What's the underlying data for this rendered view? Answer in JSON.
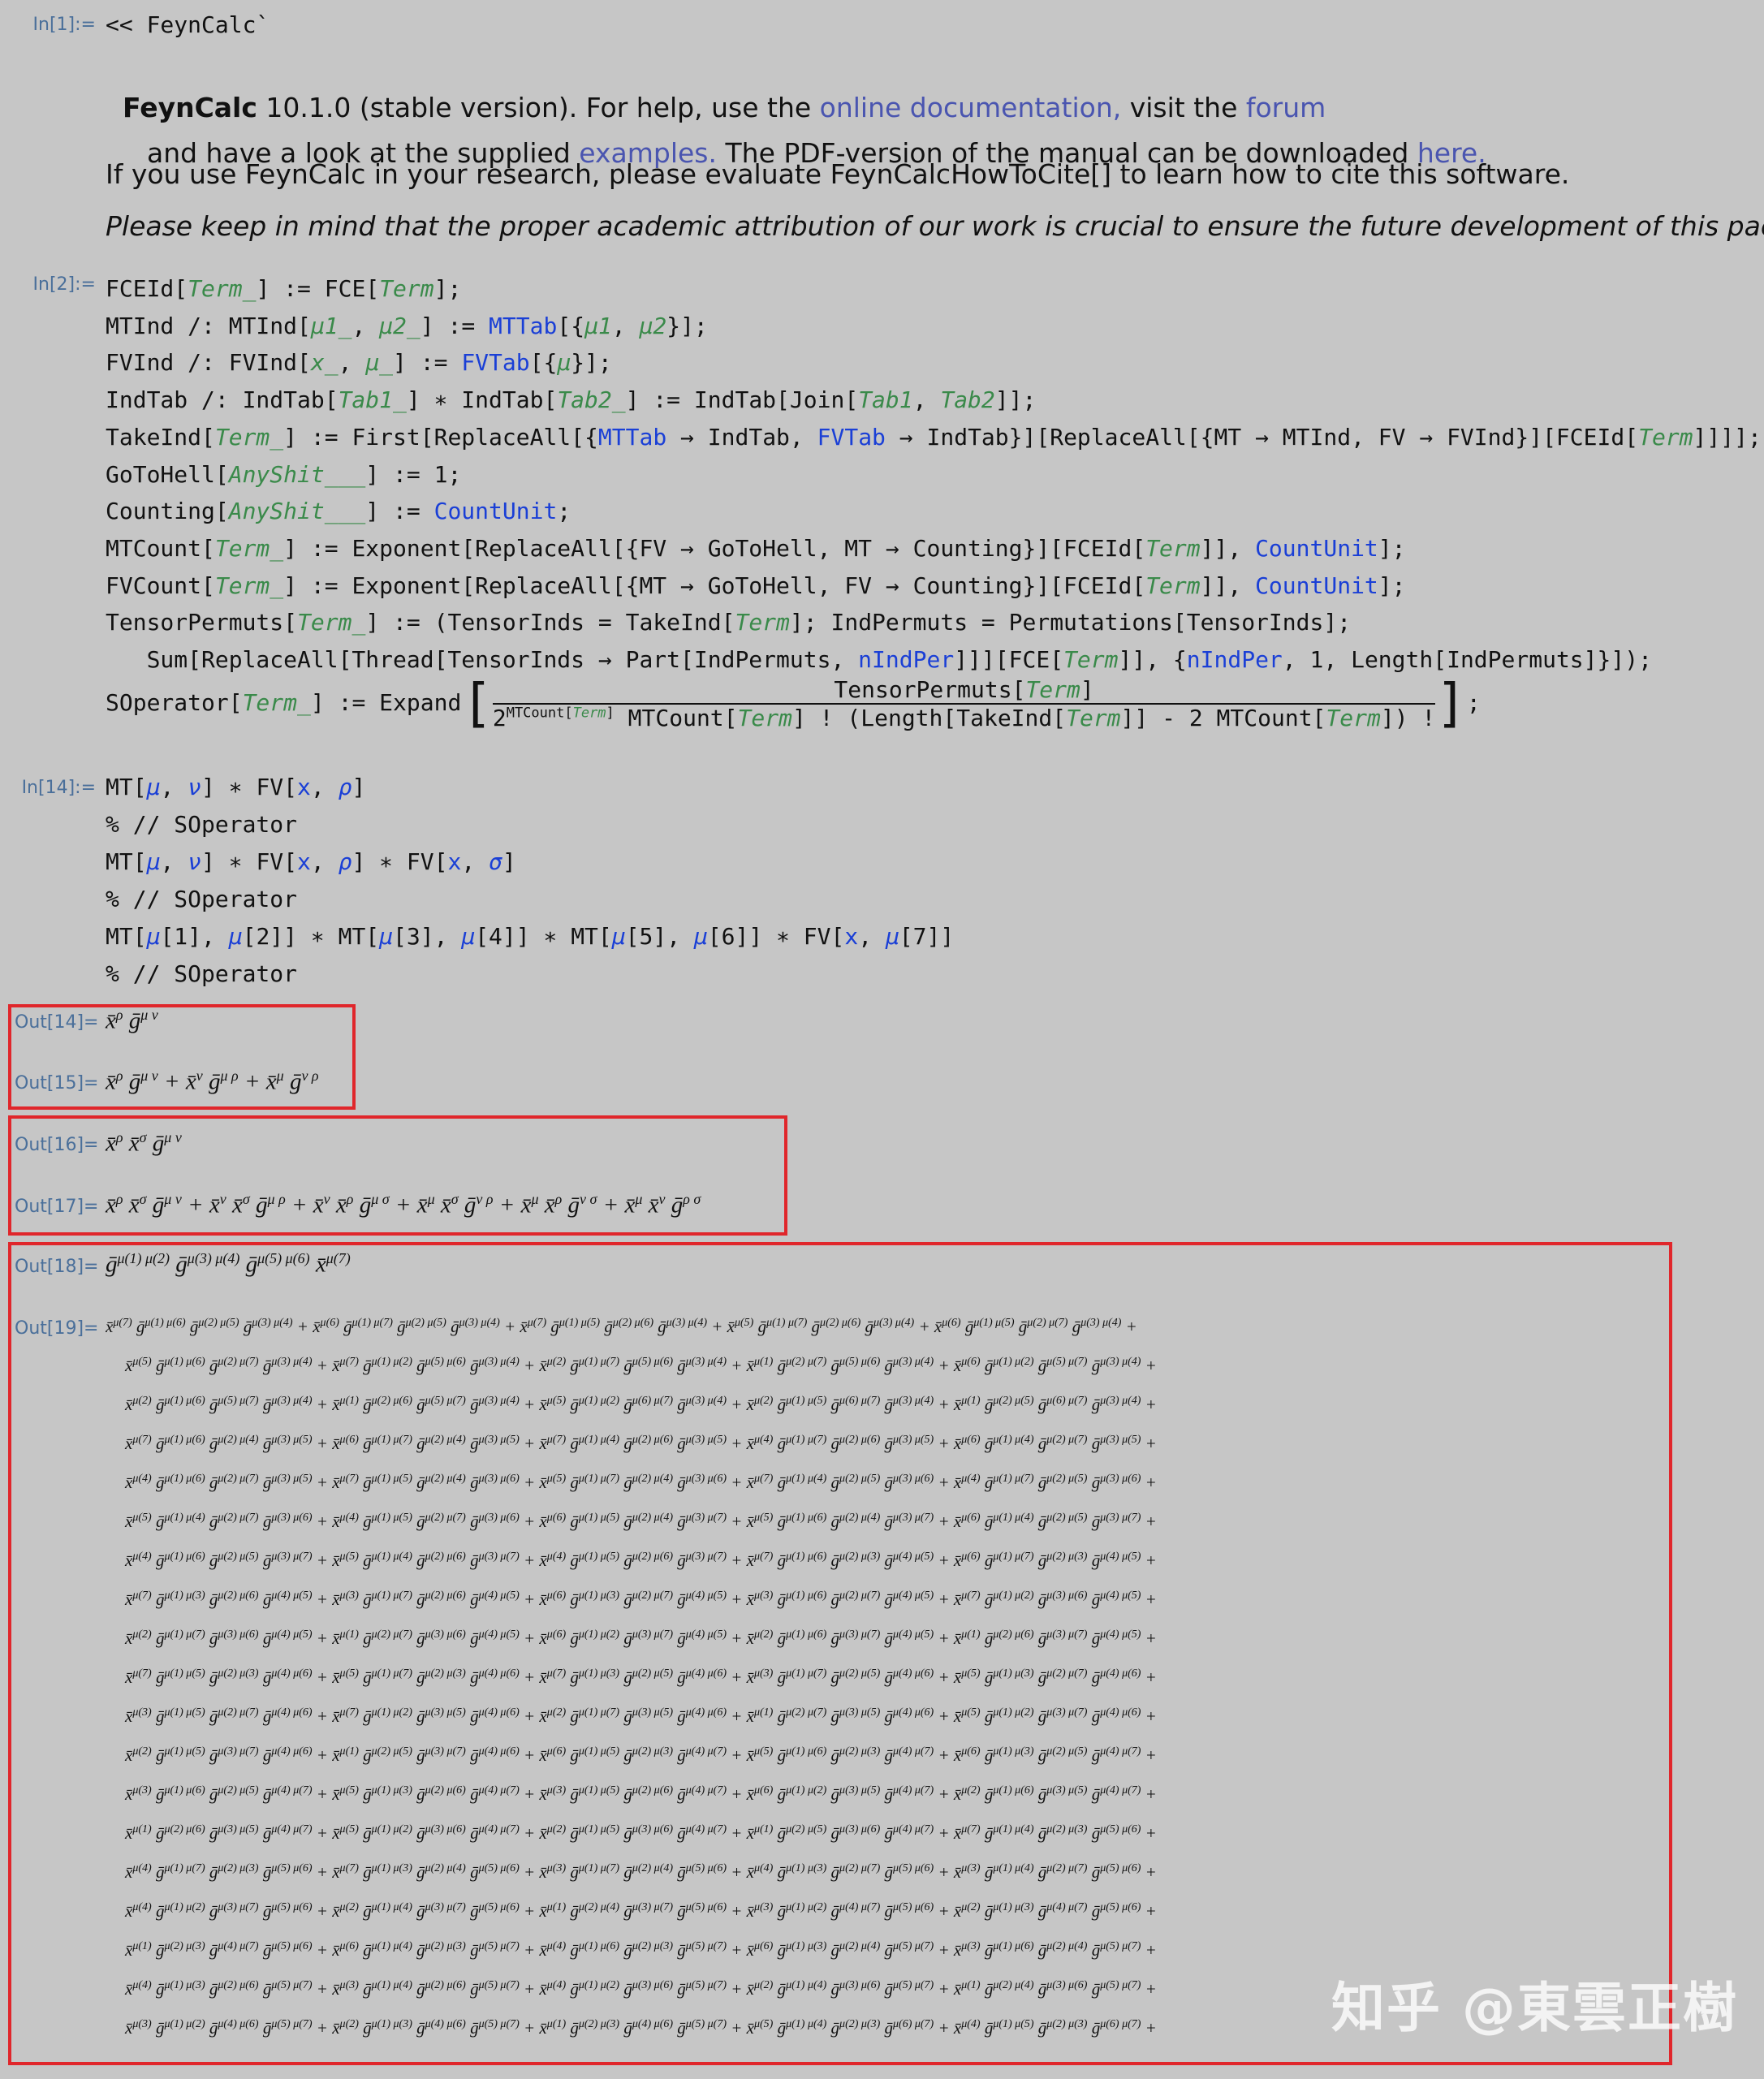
{
  "cells": {
    "in1": {
      "label": "In[1]:=",
      "code": "<< FeynCalc`"
    },
    "banner": {
      "product": "FeynCalc",
      "version": " 10.1.0 (stable version). For help, use the ",
      "doc_link": "online documentation,",
      "visit": " visit the ",
      "forum_link": "forum",
      "line2a": "and have a look at the supplied ",
      "examples_link": "examples.",
      "line2b": " The PDF-version of the manual can be downloaded ",
      "here_link": "here.",
      "cite": "If you use FeynCalc in your research, please evaluate FeynCalcHowToCite[] to learn how to cite this software.",
      "please": "Please keep in mind that the proper academic attribution of our work is crucial to ensure the future development of this package!"
    },
    "in2": {
      "label": "In[2]:="
    },
    "in14": {
      "label": "In[14]:=",
      "lines": [
        "MT[μ, ν] ∗ FV[x, ρ]",
        "% // SOperator",
        "MT[μ, ν] ∗ FV[x, ρ] ∗ FV[x, σ]",
        "% // SOperator",
        "MT[μ[1], μ[2]] ∗ MT[μ[3], μ[4]] ∗ MT[μ[5], μ[6]] ∗ FV[x, μ[7]]",
        "% // SOperator"
      ]
    },
    "outputs": {
      "out14": "Out[14]=",
      "out15": "Out[15]=",
      "out16": "Out[16]=",
      "out17": "Out[17]=",
      "out18": "Out[18]=",
      "out19": "Out[19]="
    }
  },
  "watermark": "知乎 @東雲正樹",
  "colors": {
    "background": "#c6c6c6",
    "highlight_box": "#e0262b",
    "keyword_blue": "#1a3fd6",
    "pattern_green": "#3a8a4a",
    "link": "#4a55b0"
  }
}
